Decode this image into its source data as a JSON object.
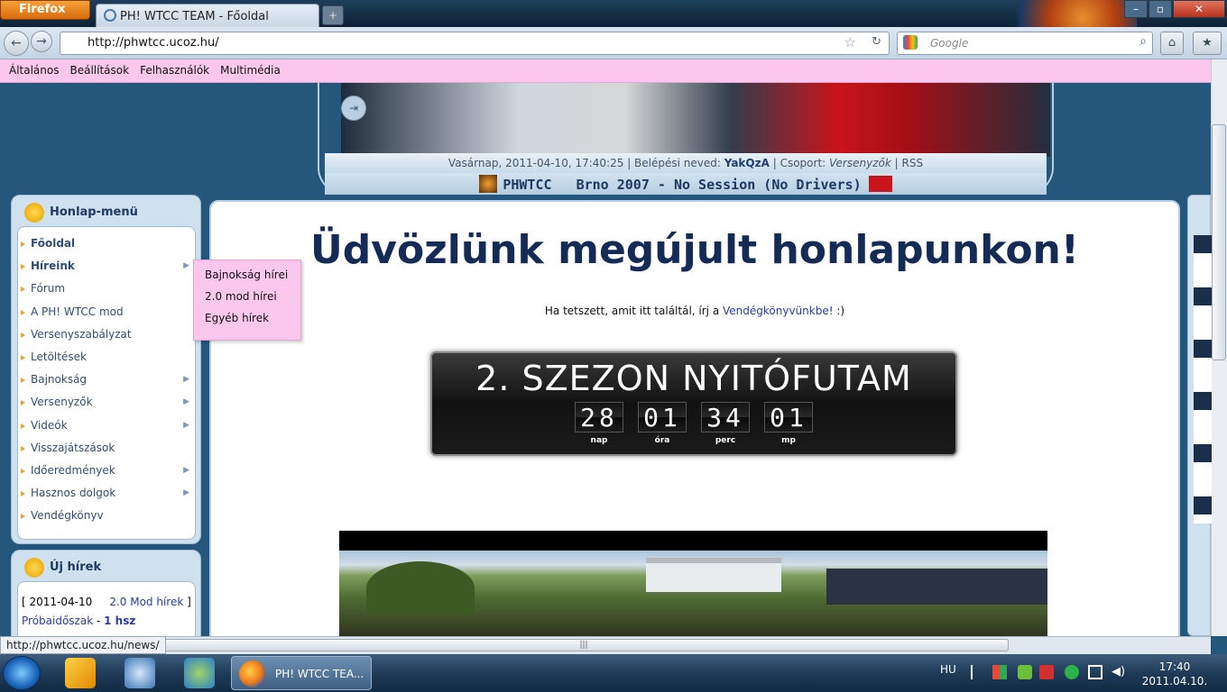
{
  "browser": {
    "menu_button": "Firefox",
    "tab_title": "PH! WTCC TEAM - Főoldal",
    "url": "http://phwtcc.ucoz.hu/",
    "search_placeholder": "Google",
    "status_url": "http://phwtcc.ucoz.hu/news/"
  },
  "admin_menu": [
    "Általános",
    "Beállítások",
    "Felhasználók",
    "Multimédia"
  ],
  "header": {
    "date": "Vasárnap, 2011-04-10, 17:40:25",
    "login_label": "| Belépési neved:",
    "username": "YakQzA",
    "group_label": "| Csoport:",
    "group": "Versenyzők",
    "rss": "| RSS",
    "session_left": "PHWTCC",
    "session_right": "Brno 2007 - No Session (No Drivers)"
  },
  "sidebar": {
    "title": "Honlap-menü",
    "items": [
      {
        "label": "Főoldal"
      },
      {
        "label": "Híreink"
      },
      {
        "label": "Fórum"
      },
      {
        "label": "A PH! WTCC mod"
      },
      {
        "label": "Versenyszabályzat"
      },
      {
        "label": "Letöltések"
      },
      {
        "label": "Bajnokság"
      },
      {
        "label": "Versenyzők"
      },
      {
        "label": "Videók"
      },
      {
        "label": "Visszajátszások"
      },
      {
        "label": "Időeredmények"
      },
      {
        "label": "Hasznos dolgok"
      },
      {
        "label": "Vendégkönyv"
      }
    ],
    "submenu": [
      "Bajnokság hírei",
      "2.0 mod hírei",
      "Egyéb hírek"
    ]
  },
  "news_panel": {
    "title": "Új hírek",
    "date": "[ 2011-04-10",
    "category": "2.0 Mod hírek",
    "bracket": "]",
    "item": "Próbaidőszak",
    "sep": "-",
    "count": "1 hsz"
  },
  "main": {
    "welcome": "Üdvözlünk megújult honlapunkon!",
    "guestbook_pre": "Ha tetszett, amit itt találtál, írj a",
    "guestbook_link": "Vendégkönyvünkbe!",
    "guestbook_post": ":)",
    "countdown": {
      "title": "2. SZEZON NYITÓFUTAM",
      "units": [
        {
          "value": "28",
          "label": "nap"
        },
        {
          "value": "01",
          "label": "óra"
        },
        {
          "value": "34",
          "label": "perc"
        },
        {
          "value": "01",
          "label": "mp"
        }
      ]
    }
  },
  "taskbar": {
    "task_label": "PH! WTCC TEA...",
    "lang": "HU",
    "time": "17:40",
    "date": "2011.04.10."
  },
  "colors": {
    "page_bg": "#25567b",
    "admin_bar": "#fbc7ec",
    "heading": "#132b55",
    "link": "#2f4d72"
  }
}
